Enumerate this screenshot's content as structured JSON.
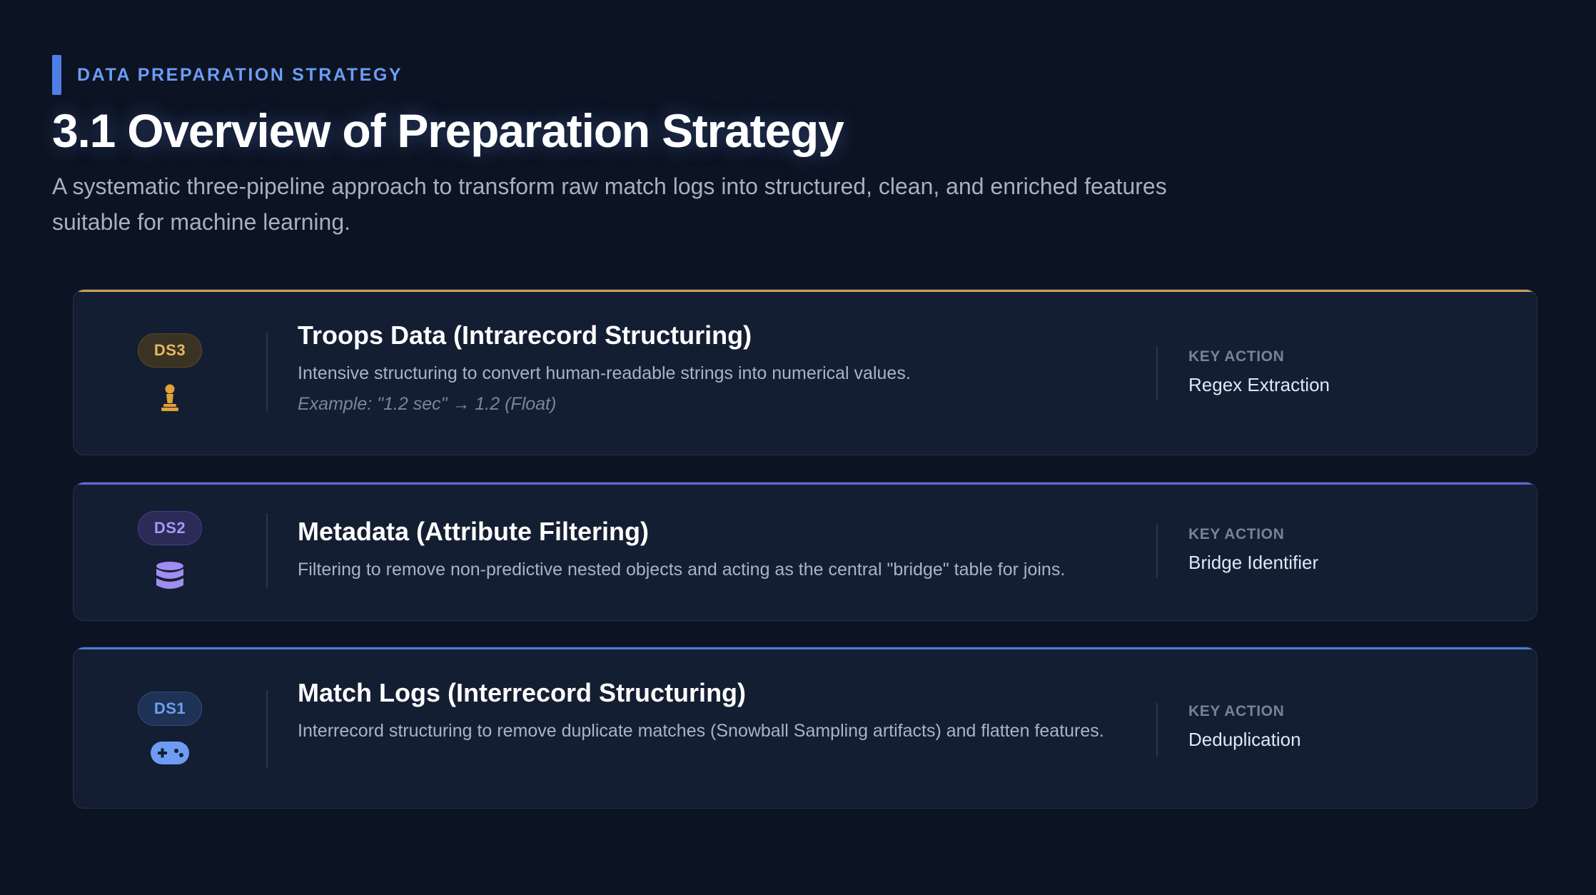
{
  "header": {
    "eyebrow": "DATA PREPARATION STRATEGY",
    "title": "3.1 Overview of Preparation Strategy",
    "subtitle": "A systematic three-pipeline approach to transform raw match logs into structured, clean, and enriched features suitable for machine learning."
  },
  "cards": [
    {
      "badge": "DS3",
      "icon": "chess-pawn-icon",
      "accent_color": "#c9a15a",
      "title": "Troops Data (Intrarecord Structuring)",
      "description": "Intensive structuring to convert human-readable strings into numerical values.",
      "example": "Example: \"1.2 sec\" → 1.2 (Float)",
      "key_label": "KEY ACTION",
      "key_value": "Regex Extraction"
    },
    {
      "badge": "DS2",
      "icon": "database-icon",
      "accent_color": "#6a63d8",
      "title": "Metadata (Attribute Filtering)",
      "description": "Filtering to remove non-predictive nested objects and acting as the central \"bridge\" table for joins.",
      "key_label": "KEY ACTION",
      "key_value": "Bridge Identifier"
    },
    {
      "badge": "DS1",
      "icon": "gamepad-icon",
      "accent_color": "#4a7ad9",
      "title": "Match Logs (Interrecord Structuring)",
      "description": "Interrecord structuring to remove duplicate matches (Snowball Sampling artifacts) and flatten features.",
      "key_label": "KEY ACTION",
      "key_value": "Deduplication"
    }
  ]
}
